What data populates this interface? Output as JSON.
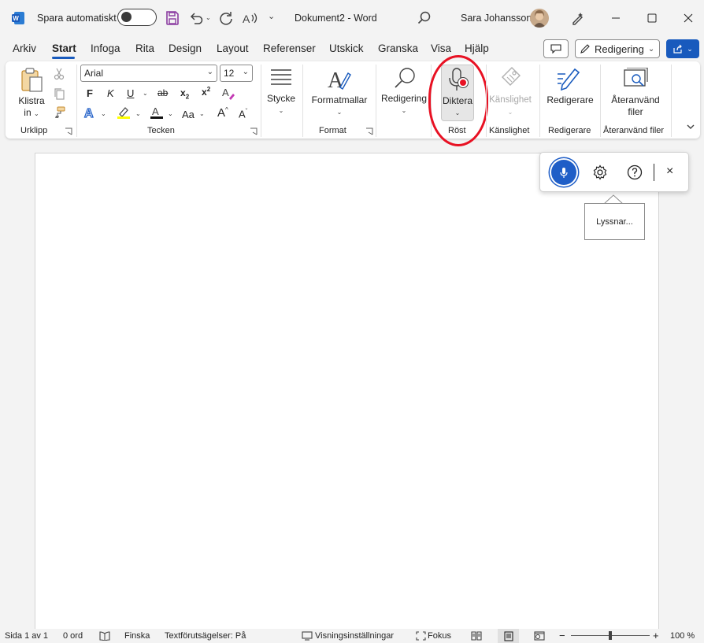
{
  "titlebar": {
    "autosave_label": "Spara automatiskt",
    "doc_title": "Dokument2",
    "separator": "-",
    "app_name": "Word",
    "user_name": "Sara Johansson"
  },
  "tabs": [
    {
      "label": "Arkiv"
    },
    {
      "label": "Start"
    },
    {
      "label": "Infoga"
    },
    {
      "label": "Rita"
    },
    {
      "label": "Design"
    },
    {
      "label": "Layout"
    },
    {
      "label": "Referenser"
    },
    {
      "label": "Utskick"
    },
    {
      "label": "Granska"
    },
    {
      "label": "Visa"
    },
    {
      "label": "Hjälp"
    }
  ],
  "top_right": {
    "editing_mode": "Redigering"
  },
  "ribbon": {
    "clipboard": {
      "paste_line1": "Klistra",
      "paste_line2": "in",
      "group": "Urklipp"
    },
    "font": {
      "font_name": "Arial",
      "font_size": "12",
      "bold": "F",
      "italic": "K",
      "underline": "U",
      "strike": "ab",
      "subscript": "x",
      "sub_mark": "2",
      "superscript": "x",
      "sup_mark": "2",
      "change_case": "Aa",
      "grow": "A",
      "shrink": "A",
      "group": "Tecken"
    },
    "paragraph": {
      "label": "Stycke"
    },
    "styles": {
      "label": "Formatmallar",
      "group": "Format"
    },
    "editing": {
      "label": "Redigering"
    },
    "voice": {
      "label": "Diktera",
      "group": "Röst"
    },
    "sensitivity": {
      "label": "Känslighet",
      "group": "Känslighet"
    },
    "editor": {
      "label": "Redigerare",
      "group": "Redigerare"
    },
    "reuse": {
      "line1": "Återanvänd",
      "line2": "filer",
      "group": "Återanvänd filer"
    }
  },
  "dictation": {
    "tooltip": "Lyssnar...",
    "close": "×"
  },
  "statusbar": {
    "page": "Sida 1 av 1",
    "words": "0 ord",
    "language": "Finska",
    "predictions": "Textförutsägelser: På",
    "display_settings": "Visningsinställningar",
    "focus": "Fokus",
    "zoom_minus": "−",
    "zoom_plus": "+",
    "zoom": "100 %"
  },
  "colors": {
    "accent": "#185abd",
    "word_blue": "#185abd",
    "highlight": "#e81123",
    "mic": "#1f5ec7"
  }
}
